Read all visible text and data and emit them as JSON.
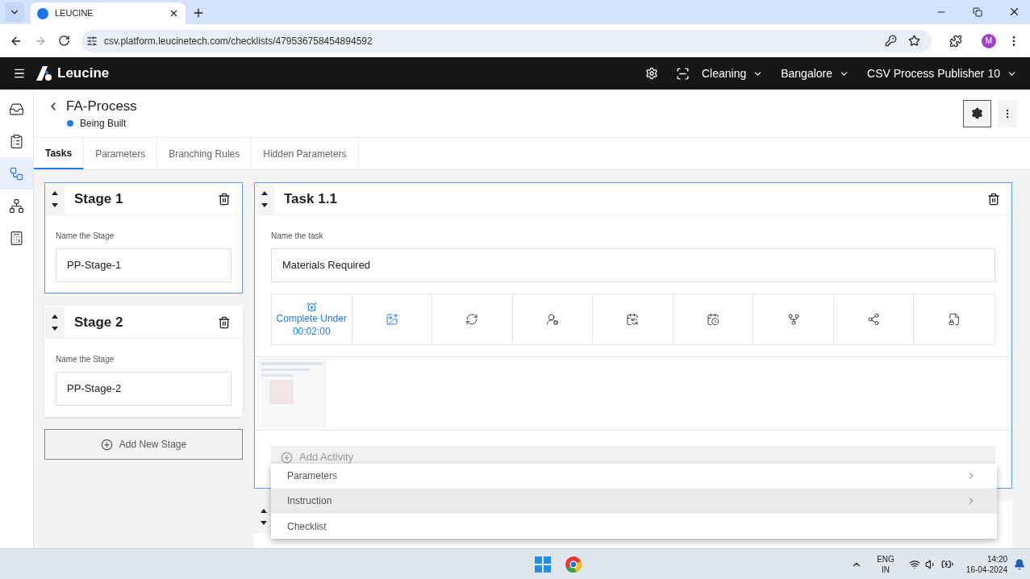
{
  "browser": {
    "tab_title": "LEUCINE",
    "url": "csv.platform.leucinetech.com/checklists/479536758454894592",
    "profile_initial": "M"
  },
  "app_header": {
    "brand": "Leucine",
    "menus": [
      "Cleaning",
      "Bangalore",
      "CSV Process Publisher 10"
    ]
  },
  "sidebar": {
    "items": [
      {
        "kind": "inbox",
        "selected": false
      },
      {
        "kind": "clipboard",
        "selected": false
      },
      {
        "kind": "flow",
        "selected": true
      },
      {
        "kind": "hierarchy",
        "selected": false
      },
      {
        "kind": "report",
        "selected": false
      }
    ]
  },
  "page": {
    "title": "FA-Process",
    "status": {
      "label": "Being Built",
      "color": "#1d7cf2"
    }
  },
  "tabs": [
    {
      "label": "Tasks",
      "selected": true
    },
    {
      "label": "Parameters",
      "selected": false
    },
    {
      "label": "Branching Rules",
      "selected": false
    },
    {
      "label": "Hidden Parameters",
      "selected": false
    }
  ],
  "stages": [
    {
      "title": "Stage 1",
      "field_label": "Name the Stage",
      "value": "PP-Stage-1",
      "selected": true
    },
    {
      "title": "Stage 2",
      "field_label": "Name the Stage",
      "value": "PP-Stage-2",
      "selected": false
    }
  ],
  "add_stage_button": "Add New Stage",
  "task": {
    "title": "Task 1.1",
    "field_label": "Name the task",
    "value": "Materials Required",
    "timer": {
      "label": "Complete Under",
      "value": "00:02:00"
    },
    "actions": [
      {
        "kind": "media",
        "active": true
      },
      {
        "kind": "recurrence",
        "active": false
      },
      {
        "kind": "assignee",
        "active": false
      },
      {
        "kind": "schedule",
        "active": false
      },
      {
        "kind": "due",
        "active": false
      },
      {
        "kind": "branch",
        "active": false
      },
      {
        "kind": "flow",
        "active": false
      },
      {
        "kind": "lock",
        "active": false
      }
    ],
    "add_activity": "Add Activity"
  },
  "activity_menu": [
    {
      "label": "Parameters",
      "submenu": true,
      "highlighted": false
    },
    {
      "label": "Instruction",
      "submenu": true,
      "highlighted": true
    },
    {
      "label": "Checklist",
      "submenu": false,
      "highlighted": false
    }
  ],
  "taskbar": {
    "language": "ENG",
    "region": "IN",
    "time": "14:20",
    "date": "16-04-2024"
  }
}
